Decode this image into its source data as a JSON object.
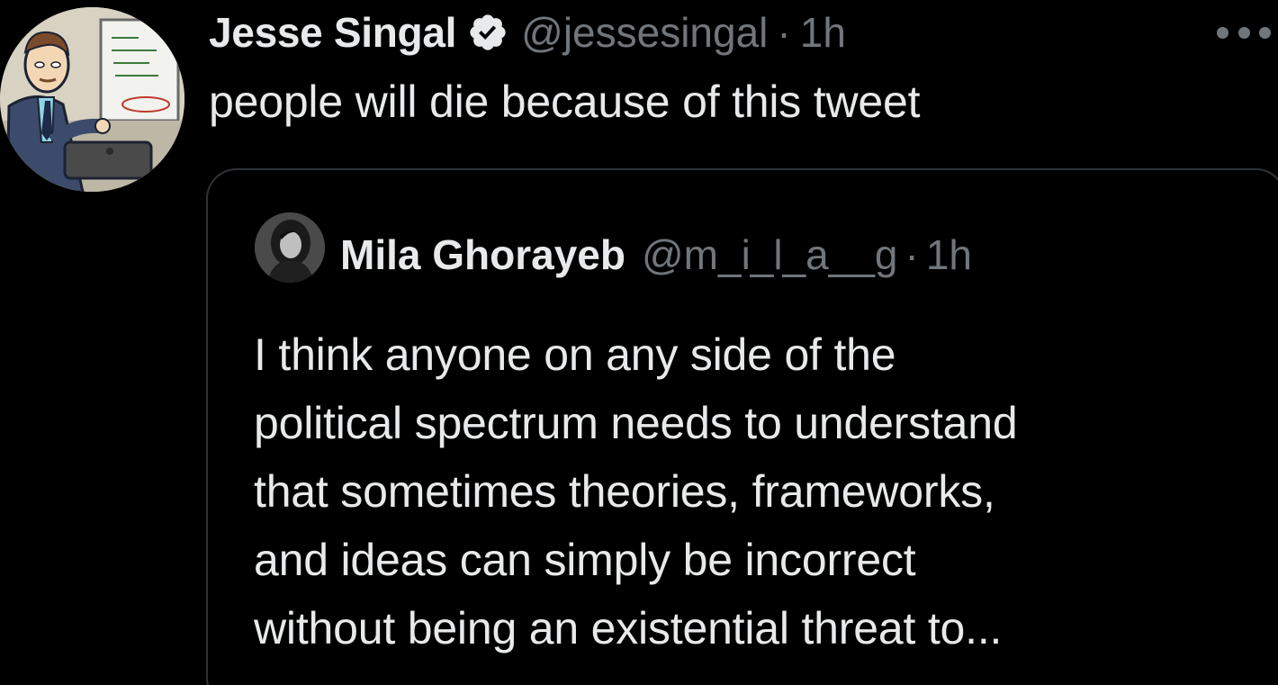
{
  "tweet": {
    "author_name": "Jesse Singal",
    "author_handle": "@jessesingal",
    "separator": "·",
    "time": "1h",
    "text": "people will die because of this tweet",
    "verified_icon": "verified-badge-icon",
    "more_icon": "more-options-icon"
  },
  "quoted_tweet": {
    "author_name": "Mila Ghorayeb",
    "author_handle": "@m_i_l_a__g",
    "separator": "·",
    "time": "1h",
    "lines": [
      "I think anyone on any side of the",
      "political spectrum needs to understand",
      "that sometimes theories, frameworks,",
      "and ideas can simply be incorrect",
      "without being an existential threat to..."
    ]
  },
  "colors": {
    "background": "#000000",
    "primary_text": "#e7e9ea",
    "secondary_text": "#71767b",
    "border": "#2f3336"
  }
}
